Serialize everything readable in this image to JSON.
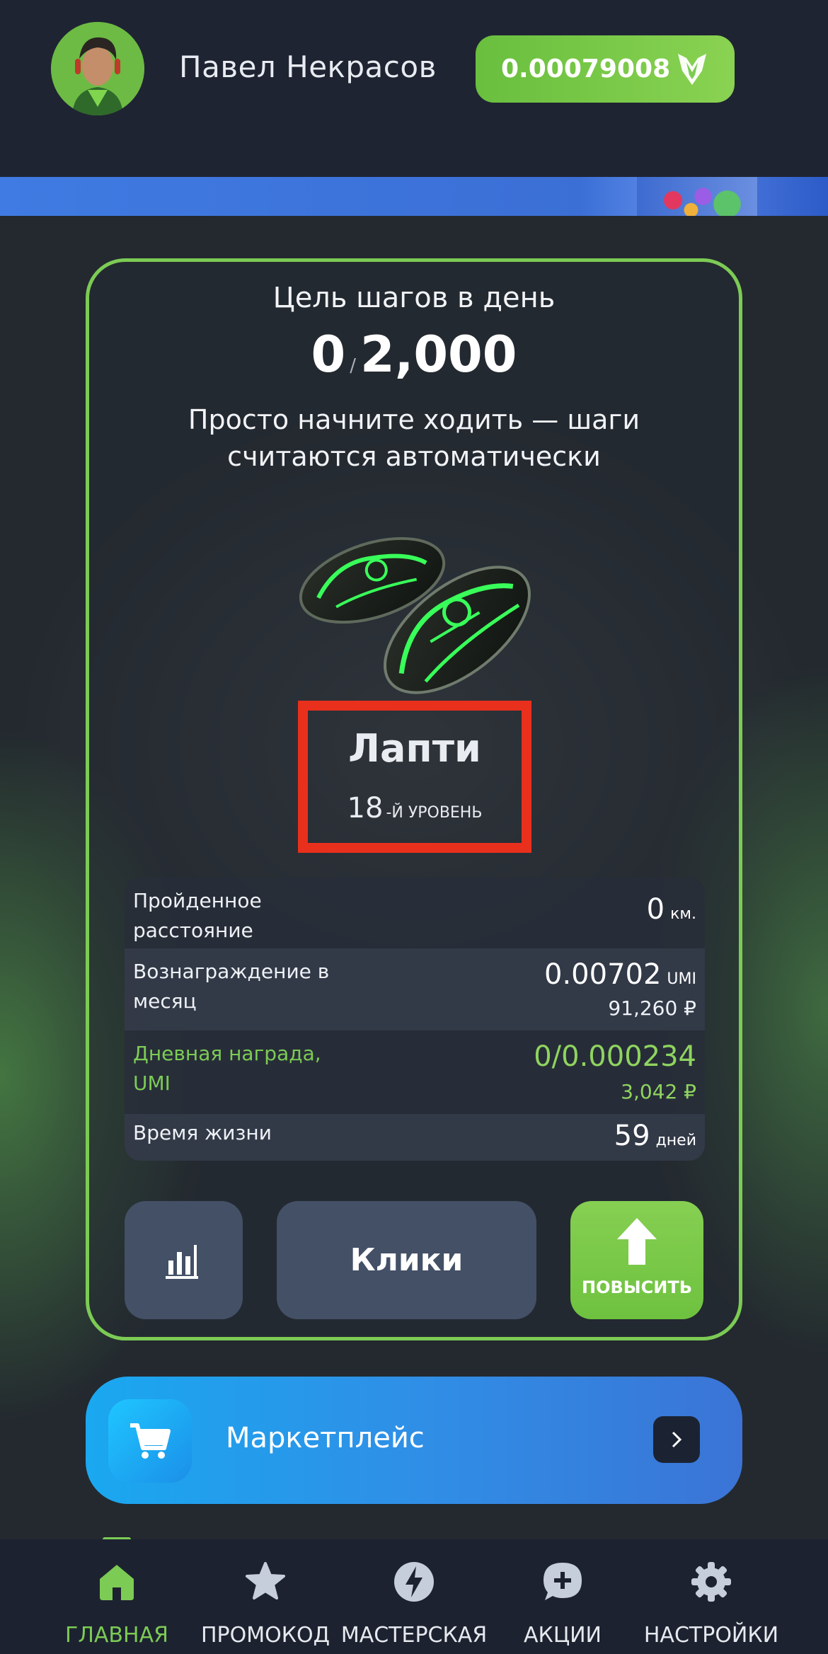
{
  "header": {
    "user_name": "Павел Некрасов",
    "balance": "0.00079008",
    "balance_icon": "umi-coin-icon",
    "accent_color": "#7ccb55"
  },
  "goal": {
    "title": "Цель шагов в день",
    "current": "0",
    "target": "2,000",
    "hint": "Просто начните ходить — шаги считаются автоматически"
  },
  "item": {
    "name": "Лапти",
    "level_num": "18",
    "level_suffix": "-Й УРОВЕНЬ"
  },
  "stats": {
    "distance": {
      "label": "Пройденное расстояние",
      "value": "0",
      "unit": "км."
    },
    "monthly": {
      "label": "Вознаграждение в месяц",
      "value": "0.00702",
      "unit": "UMI",
      "sub": "91,260 ₽"
    },
    "daily": {
      "label": "Дневная награда, UMI",
      "value": "0/0.000234",
      "sub": "3,042 ₽"
    },
    "lifetime": {
      "label": "Время жизни",
      "value": "59",
      "unit": "дней"
    }
  },
  "buttons": {
    "clicks": "Клики",
    "upgrade": "ПОВЫСИТЬ"
  },
  "marketplace": {
    "label": "Маркетплейс"
  },
  "nav": [
    {
      "label": "ГЛАВНАЯ",
      "icon": "home-icon",
      "active": true
    },
    {
      "label": "ПРОМОКОД",
      "icon": "star-icon",
      "active": false
    },
    {
      "label": "МАСТЕРСКАЯ",
      "icon": "lightning-icon",
      "active": false
    },
    {
      "label": "АКЦИИ",
      "icon": "chat-plus-icon",
      "active": false
    },
    {
      "label": "НАСТРОЙКИ",
      "icon": "gear-icon",
      "active": false
    }
  ]
}
